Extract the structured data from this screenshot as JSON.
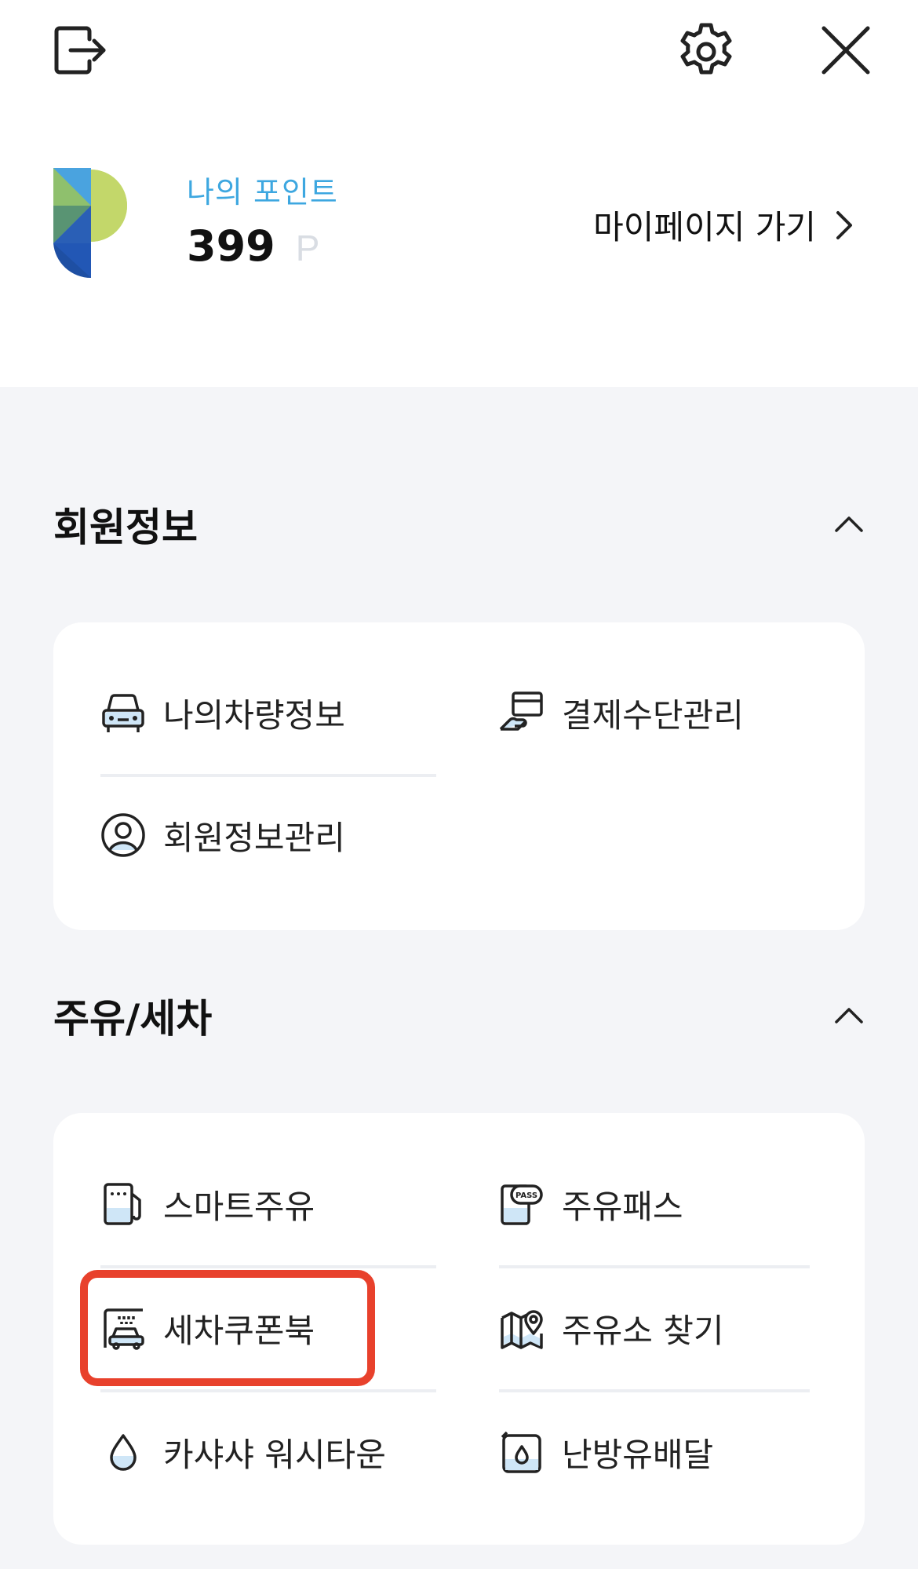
{
  "header": {
    "logout_icon": "logout-icon",
    "settings_icon": "gear-icon",
    "close_icon": "close-icon"
  },
  "points": {
    "label": "나의 포인트",
    "value": "399",
    "unit": "P",
    "mypage_link": "마이페이지 가기"
  },
  "sections": [
    {
      "title": "회원정보",
      "items": [
        {
          "label": "나의차량정보",
          "icon": "car-icon"
        },
        {
          "label": "결제수단관리",
          "icon": "payment-card-icon"
        },
        {
          "label": "회원정보관리",
          "icon": "user-profile-icon"
        }
      ]
    },
    {
      "title": "주유/세차",
      "items": [
        {
          "label": "스마트주유",
          "icon": "fuel-pump-icon"
        },
        {
          "label": "주유패스",
          "icon": "fuel-pass-icon"
        },
        {
          "label": "세차쿠폰북",
          "icon": "car-wash-icon"
        },
        {
          "label": "주유소 찾기",
          "icon": "map-pin-icon"
        },
        {
          "label": "카샤샤 워시타운",
          "icon": "water-drop-icon"
        },
        {
          "label": "난방유배달",
          "icon": "oil-can-icon"
        }
      ]
    }
  ],
  "colors": {
    "accent_blue": "#3da7e0",
    "highlight_red": "#e8412c",
    "background": "#f4f5f8"
  }
}
